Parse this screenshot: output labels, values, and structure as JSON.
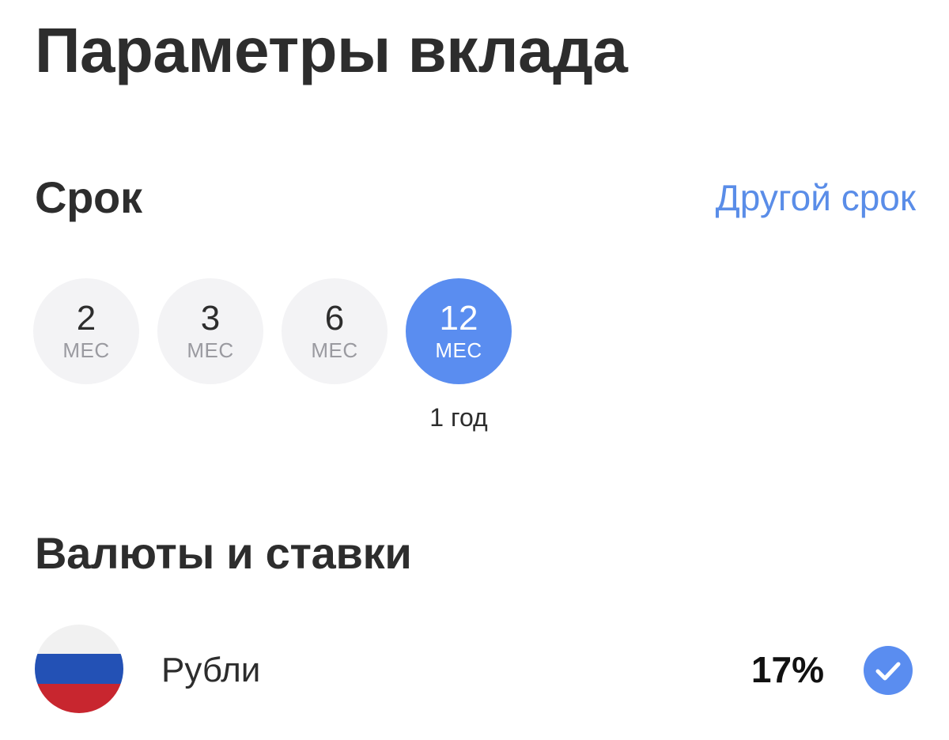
{
  "header": {
    "title": "Параметры вклада"
  },
  "term": {
    "title": "Срок",
    "other_link": "Другой срок",
    "options": [
      {
        "value": "2",
        "unit": "МЕС",
        "selected": false
      },
      {
        "value": "3",
        "unit": "МЕС",
        "selected": false
      },
      {
        "value": "6",
        "unit": "МЕС",
        "selected": false
      },
      {
        "value": "12",
        "unit": "МЕС",
        "selected": true
      }
    ],
    "selected_caption": "1 год"
  },
  "rates": {
    "title": "Валюты и ставки",
    "items": [
      {
        "flag_icon": "russia-flag-icon",
        "flag_colors": [
          "#f1f1f1",
          "#2351b5",
          "#c8262f"
        ],
        "name": "Рубли",
        "rate": "17%",
        "selected": true,
        "check_icon": "check-circle-icon",
        "check_color": "#5a8df0"
      }
    ]
  },
  "colors": {
    "accent": "#5a8df0",
    "link": "#5a8de8",
    "chip_bg": "#f3f3f5"
  }
}
